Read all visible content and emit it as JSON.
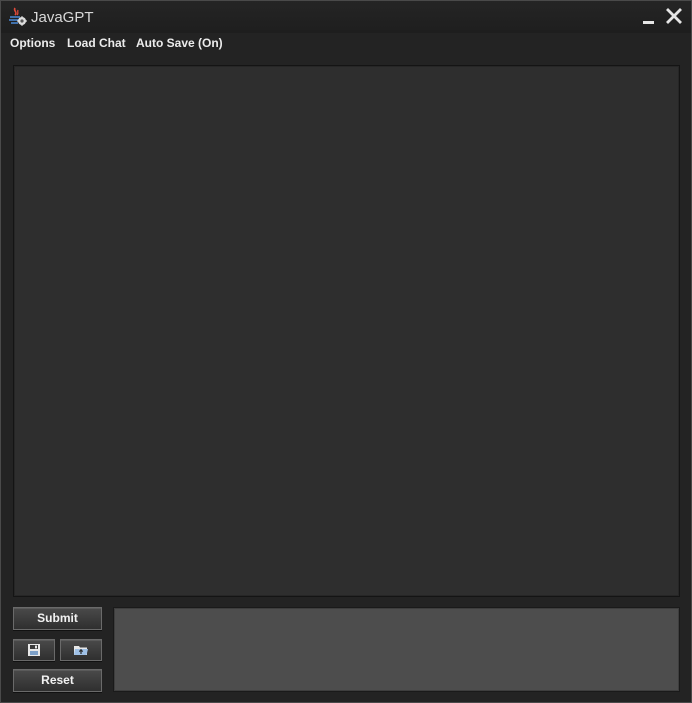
{
  "window": {
    "title": "JavaGPT"
  },
  "menu": [
    {
      "label": "Options"
    },
    {
      "label": "Load Chat"
    },
    {
      "label": "Auto Save (On)"
    }
  ],
  "chat": {
    "content": ""
  },
  "controls": {
    "submit_label": "Submit",
    "reset_label": "Reset",
    "input_value": "",
    "save_icon": "floppy-disk-icon",
    "open_icon": "folder-open-icon"
  },
  "colors": {
    "window_bg": "#232323",
    "chat_bg": "#2e2e2e",
    "input_bg": "#4d4d4d",
    "text": "#ececec"
  }
}
